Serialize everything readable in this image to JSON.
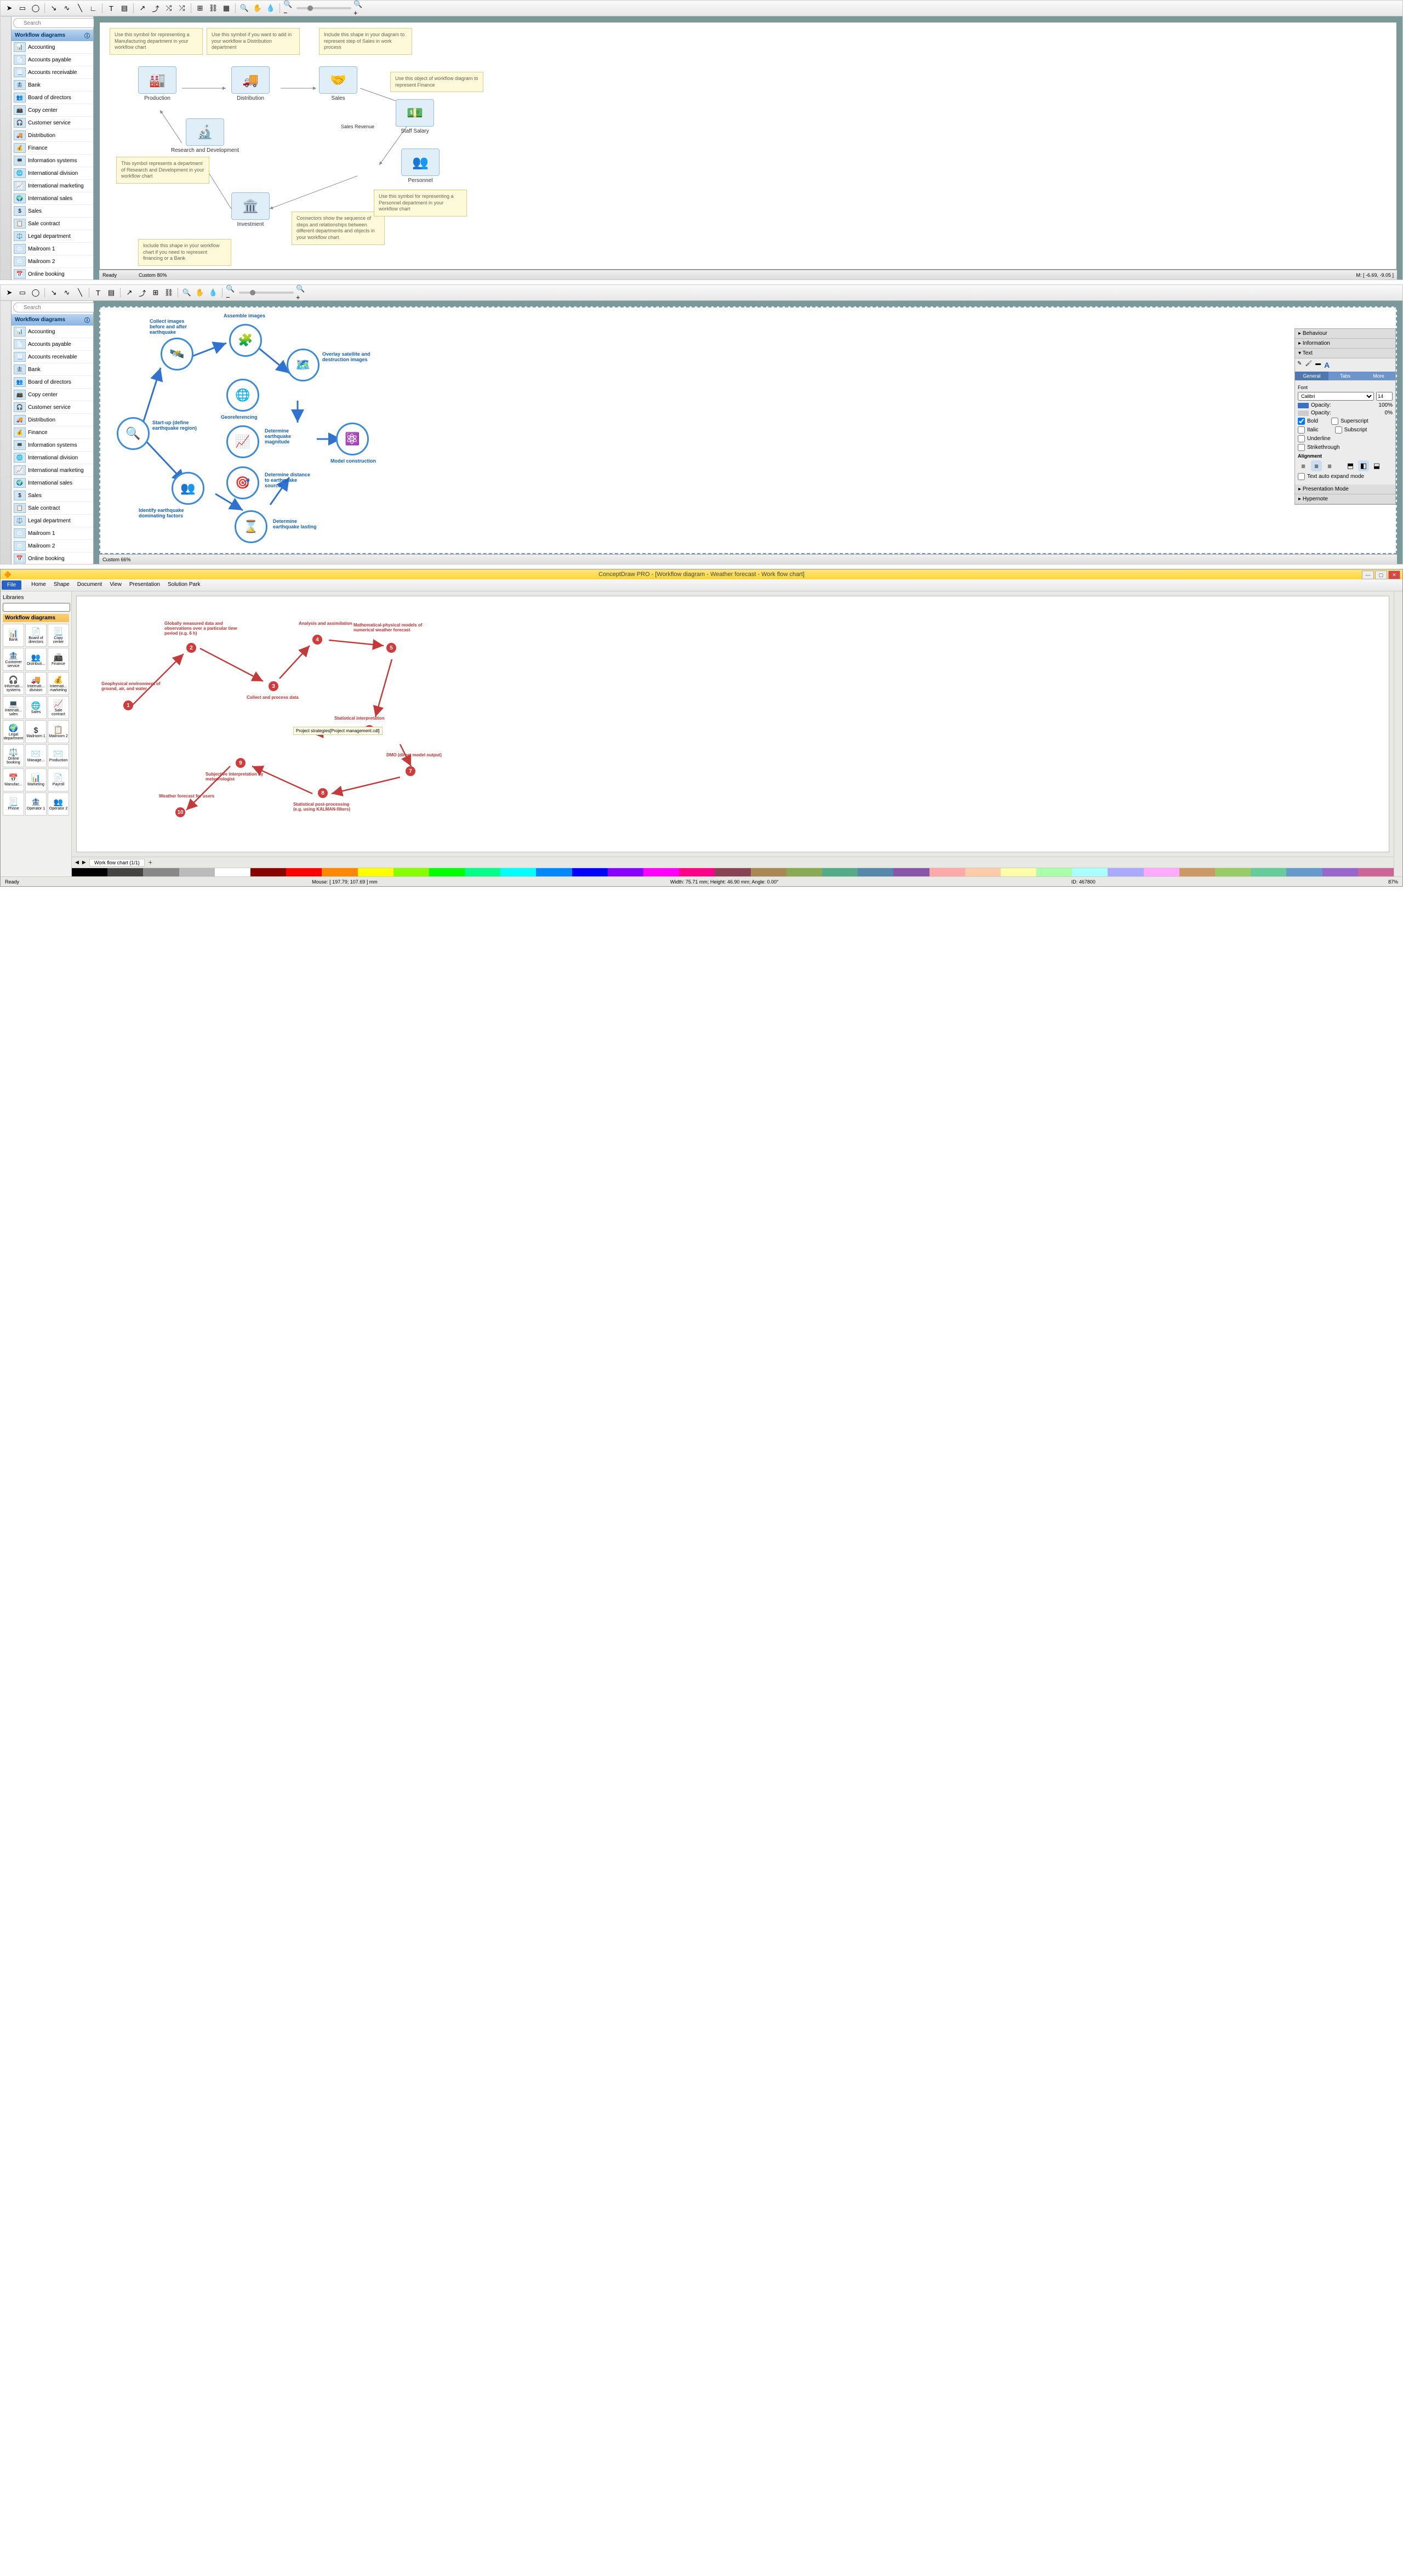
{
  "section1": {
    "search_placeholder": "Search",
    "panel_title": "Workflow diagrams",
    "lib_items": [
      "Accounting",
      "Accounts payable",
      "Accounts receivable",
      "Bank",
      "Board of directors",
      "Copy center",
      "Customer service",
      "Distribution",
      "Finance",
      "Information systems",
      "International division",
      "International marketing",
      "International sales",
      "Sales",
      "Sale contract",
      "Legal department",
      "Mailroom 1",
      "Mailroom 2",
      "Online booking"
    ],
    "zoom_label": "Custom 80%",
    "mouse_status": "M: [ -6.69, -9.05 ]",
    "ready": "Ready",
    "nodes": {
      "production": "Production",
      "distribution": "Distribution",
      "sales": "Sales",
      "rnd": "Research and Development",
      "staff_salary": "Staff Salary",
      "sales_revenue": "Sales Revenue",
      "personnel": "Personnel",
      "investment": "Investment"
    },
    "callouts": {
      "c1": "Use this symbol for representing a Manufacturing department in your workflow chart",
      "c2": "Use this symbol if you want to add in your workflow a Distribution department",
      "c3": "Include this shape in your diagram to represent step of Sales in work process",
      "c4": "Use this object of workflow diagram to represent Finance",
      "c5": "This symbol represents a department of Research and Development in your workflow chart",
      "c6": "Connectors show the sequence of steps and relationships between different departments and objects in your workflow chart",
      "c7": "Use this symbol for representing a Personnel department in your workflow chart",
      "c8": "Include this shape in your workflow chart if you need to represent financing or a Bank"
    }
  },
  "section2": {
    "search_placeholder": "Search",
    "panel_title": "Workflow diagrams",
    "lib_items": [
      "Accounting",
      "Accounts payable",
      "Accounts receivable",
      "Bank",
      "Board of directors",
      "Copy center",
      "Customer service",
      "Distribution",
      "Finance",
      "Information systems",
      "International division",
      "International marketing",
      "International sales",
      "Sales",
      "Sale contract",
      "Legal department",
      "Mailroom 1",
      "Mailroom 2",
      "Online booking"
    ],
    "zoom_label": "Custom 66%",
    "nodes": {
      "startup": "Start-up (define earthquake region)",
      "collect": "Collect images before and after earthquake",
      "assemble": "Assemble images",
      "georef": "Georeferencing",
      "overlay": "Overlay satellite and destruction images",
      "magnitude": "Determine earthquake magnitude",
      "model": "Model construction",
      "distance": "Determine distance to earthquake source",
      "identify": "Identify earthquake dominating factors",
      "lasting": "Determine earthquake lasting"
    },
    "props": {
      "behaviour": "Behaviour",
      "information": "Information",
      "text": "Text",
      "tab_general": "General",
      "tab_tabs": "Tabs",
      "tab_more": "More",
      "font_label": "Font",
      "font_value": "Calibri",
      "font_size": "14",
      "opacity_label": "Opacity:",
      "opacity1": "100%",
      "opacity2": "0%",
      "bold": "Bold",
      "italic": "Italic",
      "underline": "Underline",
      "strike": "Strikethrough",
      "superscript": "Superscript",
      "subscript": "Subscript",
      "alignment": "Alignment",
      "autoexpand": "Text auto expand mode",
      "presentation": "Presentation Mode",
      "hypernote": "Hypernote"
    }
  },
  "section3": {
    "title": "ConceptDraw PRO - [Workflow diagram - Weather forecast - Work flow chart]",
    "menu": {
      "file": "File",
      "home": "Home",
      "shape": "Shape",
      "document": "Document",
      "view": "View",
      "presentation": "Presentation",
      "solutionpark": "Solution Park"
    },
    "libraries_label": "Libraries",
    "lib_header": "Workflow diagrams",
    "lib_items": [
      "Bank",
      "Board of directors",
      "Copy center",
      "Customer service",
      "Distributi...",
      "Finance",
      "Informati... systems",
      "Internati... division",
      "Internati... marketing",
      "Internati... sales",
      "Sales",
      "Sale contract",
      "Legal department",
      "Mailroom 1",
      "Mailroom 2",
      "Online booking",
      "Manage...",
      "Production",
      "Manufac...",
      "Marketing",
      "Payroll",
      "Phone",
      "Operator 1",
      "Operator 2"
    ],
    "nodes": {
      "n1": "Geophysical environment of ground, air, and water",
      "n2": "Globally measured data and observations over a particular time period (e.g. 6 h)",
      "n3": "Collect and process data",
      "n4": "Analysis and assimilation",
      "n5": "Mathematical-physical models of numerical weather forecast",
      "n6": "Statistical interpretation",
      "n7": "DMO (direct model output)",
      "n8": "Statistical post-processing (e.g. using KALMAN-filters)",
      "n9": "Subjective interpretation by meteorologist",
      "n10": "Weather forecast for users",
      "tooltip": "Project strategies[Project management.cdl]"
    },
    "tab_label": "Work flow chart (1/1)",
    "status": {
      "ready": "Ready",
      "mouse": "Mouse: [ 197.79; 107.69 ] mm",
      "dims": "Width: 75.71 mm; Height: 46.90 mm; Angle: 0.00°",
      "id": "ID: 467800",
      "zoom": "87%"
    }
  }
}
